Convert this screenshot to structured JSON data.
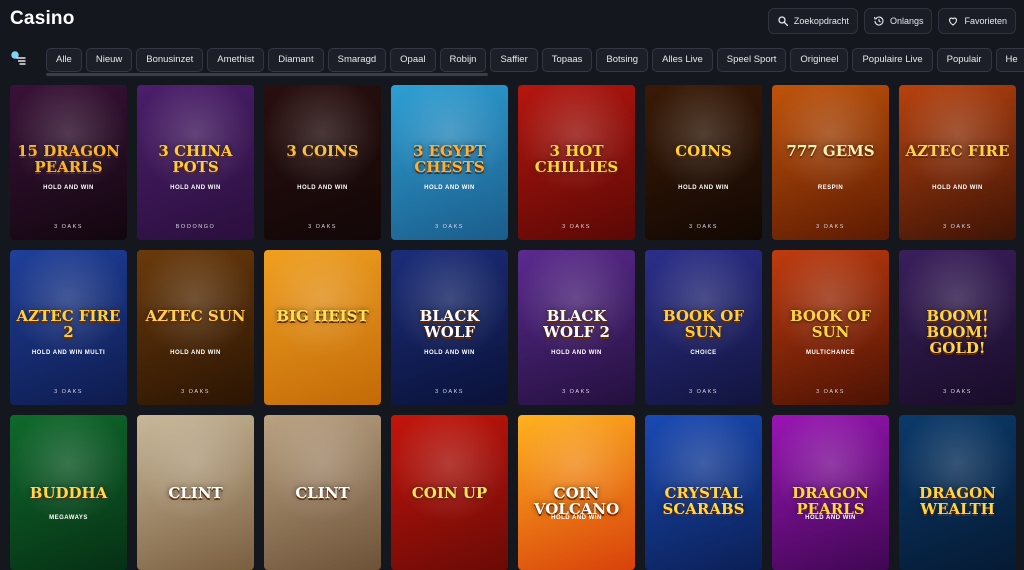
{
  "header": {
    "title": "Casino",
    "actions": [
      {
        "label": "Zoekopdracht",
        "icon": "search-icon"
      },
      {
        "label": "Onlangs",
        "icon": "history-icon"
      },
      {
        "label": "Favorieten",
        "icon": "heart-icon"
      }
    ]
  },
  "tabs": [
    "Alle",
    "Nieuw",
    "Bonusinzet",
    "Amethist",
    "Diamant",
    "Smaragd",
    "Opaal",
    "Robijn",
    "Saffier",
    "Topaas",
    "Botsing",
    "Alles Live",
    "Speel Sport",
    "Origineel",
    "Populaire Live",
    "Populair",
    "He"
  ],
  "games": [
    {
      "name": "15 DRAGON PEARLS",
      "sub": "HOLD AND WIN",
      "provider": "3 OAKS",
      "bg": "#3a1238",
      "bg2": "#12060f",
      "color": "#f7b733"
    },
    {
      "name": "3 CHINA POTS",
      "sub": "HOLD AND WIN",
      "provider": "BOOONGO",
      "bg": "#4b1e6b",
      "bg2": "#2a0f3d",
      "color": "#ffcb3a"
    },
    {
      "name": "3 COINS",
      "sub": "HOLD AND WIN",
      "provider": "3 OAKS",
      "bg": "#2a0f0f",
      "bg2": "#120707",
      "color": "#f2c24b"
    },
    {
      "name": "3 EGYPT CHESTS",
      "sub": "HOLD AND WIN",
      "provider": "3 OAKS",
      "bg": "#2d9fd4",
      "bg2": "#1b5c8a",
      "color": "#ffb02e"
    },
    {
      "name": "3 HOT CHILLIES",
      "sub": "",
      "provider": "3 OAKS",
      "bg": "#b5160f",
      "bg2": "#5a0805",
      "color": "#ffd43b"
    },
    {
      "name": "COINS",
      "sub": "HOLD AND WIN",
      "provider": "3 OAKS",
      "bg": "#3a1a06",
      "bg2": "#120803",
      "color": "#ffcf33"
    },
    {
      "name": "777 GEMS",
      "sub": "RESPIN",
      "provider": "3 OAKS",
      "bg": "#c0530a",
      "bg2": "#5c1a02",
      "color": "#fff0b0"
    },
    {
      "name": "AZTEC FIRE",
      "sub": "HOLD AND WIN",
      "provider": "3 OAKS",
      "bg": "#b8420e",
      "bg2": "#3d1306",
      "color": "#ffd04a"
    },
    {
      "name": "AZTEC FIRE 2",
      "sub": "HOLD AND WIN MULTI",
      "provider": "3 OAKS",
      "bg": "#1f3f9a",
      "bg2": "#0e1b4d",
      "color": "#ffd23f"
    },
    {
      "name": "AZTEC SUN",
      "sub": "HOLD AND WIN",
      "provider": "3 OAKS",
      "bg": "#6a3a0b",
      "bg2": "#2a1403",
      "color": "#ffcf55"
    },
    {
      "name": "BIG HEIST",
      "sub": "",
      "provider": "",
      "bg": "#f0a020",
      "bg2": "#c26a08",
      "color": "#ffe15a"
    },
    {
      "name": "BLACK WOLF",
      "sub": "HOLD AND WIN",
      "provider": "3 OAKS",
      "bg": "#1b2d7a",
      "bg2": "#0a1238",
      "color": "#ffffff"
    },
    {
      "name": "BLACK WOLF 2",
      "sub": "HOLD AND WIN",
      "provider": "3 OAKS",
      "bg": "#5b2a8f",
      "bg2": "#23103d",
      "color": "#ffffff"
    },
    {
      "name": "BOOK OF SUN",
      "sub": "CHOICE",
      "provider": "3 OAKS",
      "bg": "#2b2f8a",
      "bg2": "#12143d",
      "color": "#ffce3d"
    },
    {
      "name": "BOOK OF SUN",
      "sub": "MULTICHANCE",
      "provider": "3 OAKS",
      "bg": "#c03b0e",
      "bg2": "#4a1204",
      "color": "#ffd447"
    },
    {
      "name": "BOOM! BOOM! GOLD!",
      "sub": "",
      "provider": "3 OAKS",
      "bg": "#3a1f5c",
      "bg2": "#180c28",
      "color": "#ffd447"
    },
    {
      "name": "BUDDHA",
      "sub": "MEGAWAYS",
      "provider": "",
      "bg": "#0f6a2c",
      "bg2": "#063014",
      "color": "#ffd94a"
    },
    {
      "name": "CLINT",
      "sub": "",
      "provider": "",
      "bg": "#c9b89a",
      "bg2": "#7a5f3f",
      "color": "#ffffff"
    },
    {
      "name": "CLINT",
      "sub": "",
      "provider": "",
      "bg": "#bba283",
      "bg2": "#6d5237",
      "color": "#ffffff"
    },
    {
      "name": "COIN UP",
      "sub": "",
      "provider": "",
      "bg": "#c4150c",
      "bg2": "#6a0a06",
      "color": "#ffe35a"
    },
    {
      "name": "COIN VOLCANO",
      "sub": "HOLD AND WIN",
      "provider": "",
      "bg": "#ffb21f",
      "bg2": "#d8410b",
      "color": "#ffffff"
    },
    {
      "name": "CRYSTAL SCARABS",
      "sub": "",
      "provider": "",
      "bg": "#1a4ab5",
      "bg2": "#0b1f55",
      "color": "#ffd84a"
    },
    {
      "name": "DRAGON PEARLS",
      "sub": "HOLD AND WIN",
      "provider": "",
      "bg": "#9a15b5",
      "bg2": "#3f0752",
      "color": "#ffd447"
    },
    {
      "name": "DRAGON WEALTH",
      "sub": "",
      "provider": "",
      "bg": "#0b3a6b",
      "bg2": "#051a33",
      "color": "#ffd447"
    }
  ]
}
